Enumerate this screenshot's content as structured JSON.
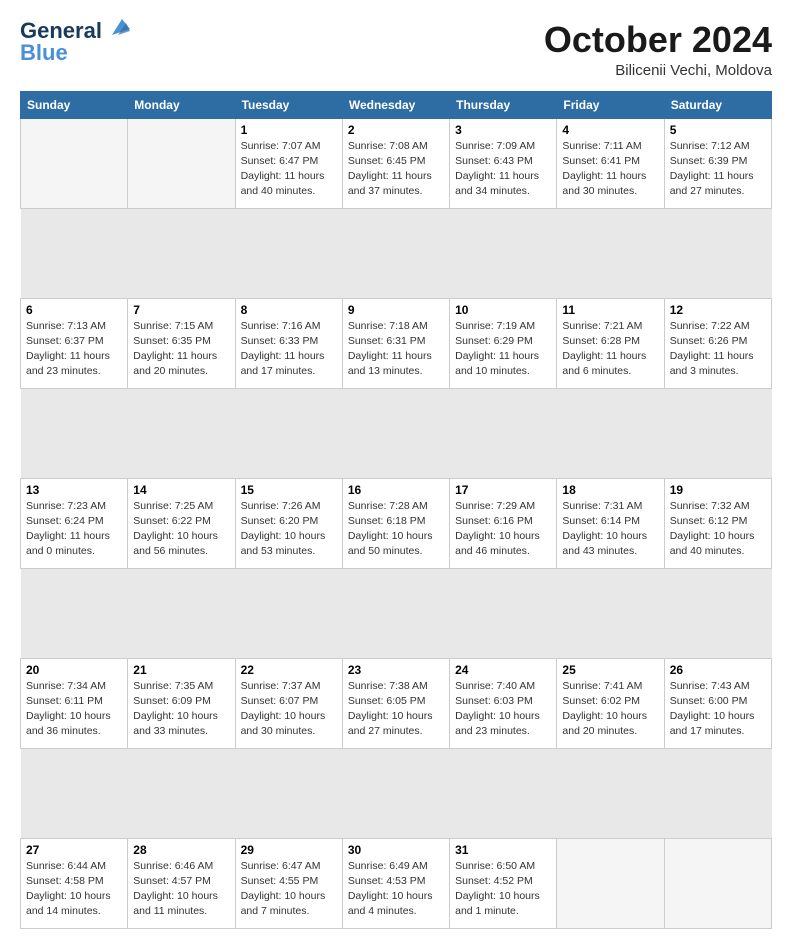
{
  "header": {
    "logo_line1": "General",
    "logo_line2": "Blue",
    "month": "October 2024",
    "location": "Bilicenii Vechi, Moldova"
  },
  "weekdays": [
    "Sunday",
    "Monday",
    "Tuesday",
    "Wednesday",
    "Thursday",
    "Friday",
    "Saturday"
  ],
  "weeks": [
    [
      {
        "day": "",
        "info": ""
      },
      {
        "day": "",
        "info": ""
      },
      {
        "day": "1",
        "info": "Sunrise: 7:07 AM\nSunset: 6:47 PM\nDaylight: 11 hours and 40 minutes."
      },
      {
        "day": "2",
        "info": "Sunrise: 7:08 AM\nSunset: 6:45 PM\nDaylight: 11 hours and 37 minutes."
      },
      {
        "day": "3",
        "info": "Sunrise: 7:09 AM\nSunset: 6:43 PM\nDaylight: 11 hours and 34 minutes."
      },
      {
        "day": "4",
        "info": "Sunrise: 7:11 AM\nSunset: 6:41 PM\nDaylight: 11 hours and 30 minutes."
      },
      {
        "day": "5",
        "info": "Sunrise: 7:12 AM\nSunset: 6:39 PM\nDaylight: 11 hours and 27 minutes."
      }
    ],
    [
      {
        "day": "6",
        "info": "Sunrise: 7:13 AM\nSunset: 6:37 PM\nDaylight: 11 hours and 23 minutes."
      },
      {
        "day": "7",
        "info": "Sunrise: 7:15 AM\nSunset: 6:35 PM\nDaylight: 11 hours and 20 minutes."
      },
      {
        "day": "8",
        "info": "Sunrise: 7:16 AM\nSunset: 6:33 PM\nDaylight: 11 hours and 17 minutes."
      },
      {
        "day": "9",
        "info": "Sunrise: 7:18 AM\nSunset: 6:31 PM\nDaylight: 11 hours and 13 minutes."
      },
      {
        "day": "10",
        "info": "Sunrise: 7:19 AM\nSunset: 6:29 PM\nDaylight: 11 hours and 10 minutes."
      },
      {
        "day": "11",
        "info": "Sunrise: 7:21 AM\nSunset: 6:28 PM\nDaylight: 11 hours and 6 minutes."
      },
      {
        "day": "12",
        "info": "Sunrise: 7:22 AM\nSunset: 6:26 PM\nDaylight: 11 hours and 3 minutes."
      }
    ],
    [
      {
        "day": "13",
        "info": "Sunrise: 7:23 AM\nSunset: 6:24 PM\nDaylight: 11 hours and 0 minutes."
      },
      {
        "day": "14",
        "info": "Sunrise: 7:25 AM\nSunset: 6:22 PM\nDaylight: 10 hours and 56 minutes."
      },
      {
        "day": "15",
        "info": "Sunrise: 7:26 AM\nSunset: 6:20 PM\nDaylight: 10 hours and 53 minutes."
      },
      {
        "day": "16",
        "info": "Sunrise: 7:28 AM\nSunset: 6:18 PM\nDaylight: 10 hours and 50 minutes."
      },
      {
        "day": "17",
        "info": "Sunrise: 7:29 AM\nSunset: 6:16 PM\nDaylight: 10 hours and 46 minutes."
      },
      {
        "day": "18",
        "info": "Sunrise: 7:31 AM\nSunset: 6:14 PM\nDaylight: 10 hours and 43 minutes."
      },
      {
        "day": "19",
        "info": "Sunrise: 7:32 AM\nSunset: 6:12 PM\nDaylight: 10 hours and 40 minutes."
      }
    ],
    [
      {
        "day": "20",
        "info": "Sunrise: 7:34 AM\nSunset: 6:11 PM\nDaylight: 10 hours and 36 minutes."
      },
      {
        "day": "21",
        "info": "Sunrise: 7:35 AM\nSunset: 6:09 PM\nDaylight: 10 hours and 33 minutes."
      },
      {
        "day": "22",
        "info": "Sunrise: 7:37 AM\nSunset: 6:07 PM\nDaylight: 10 hours and 30 minutes."
      },
      {
        "day": "23",
        "info": "Sunrise: 7:38 AM\nSunset: 6:05 PM\nDaylight: 10 hours and 27 minutes."
      },
      {
        "day": "24",
        "info": "Sunrise: 7:40 AM\nSunset: 6:03 PM\nDaylight: 10 hours and 23 minutes."
      },
      {
        "day": "25",
        "info": "Sunrise: 7:41 AM\nSunset: 6:02 PM\nDaylight: 10 hours and 20 minutes."
      },
      {
        "day": "26",
        "info": "Sunrise: 7:43 AM\nSunset: 6:00 PM\nDaylight: 10 hours and 17 minutes."
      }
    ],
    [
      {
        "day": "27",
        "info": "Sunrise: 6:44 AM\nSunset: 4:58 PM\nDaylight: 10 hours and 14 minutes."
      },
      {
        "day": "28",
        "info": "Sunrise: 6:46 AM\nSunset: 4:57 PM\nDaylight: 10 hours and 11 minutes."
      },
      {
        "day": "29",
        "info": "Sunrise: 6:47 AM\nSunset: 4:55 PM\nDaylight: 10 hours and 7 minutes."
      },
      {
        "day": "30",
        "info": "Sunrise: 6:49 AM\nSunset: 4:53 PM\nDaylight: 10 hours and 4 minutes."
      },
      {
        "day": "31",
        "info": "Sunrise: 6:50 AM\nSunset: 4:52 PM\nDaylight: 10 hours and 1 minute."
      },
      {
        "day": "",
        "info": ""
      },
      {
        "day": "",
        "info": ""
      }
    ]
  ]
}
